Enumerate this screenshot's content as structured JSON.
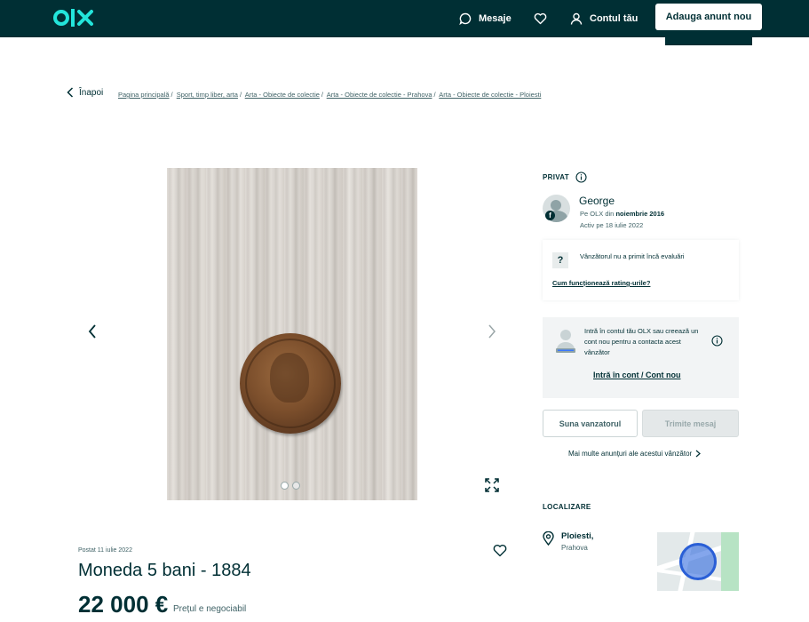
{
  "header": {
    "logo": "OLX",
    "messages_label": "Mesaje",
    "account_label": "Contul tău",
    "post_ad_label": "Adauga anunt nou"
  },
  "breadcrumb": {
    "back_label": "Înapoi",
    "items": [
      "Pagina principală",
      "Sport, timp liber, arta",
      "Arta - Obiecte de colectie",
      "Arta - Obiecte de colectie - Prahova",
      "Arta - Obiecte de colectie - Ploiesti"
    ]
  },
  "gallery": {
    "photo_count": 2,
    "active_index": 1
  },
  "ad": {
    "posted": "Postat 11 iulie 2022",
    "title": "Moneda 5 bani - 1884",
    "price": "22 000 €",
    "negotiable": "Prețul e negociabil"
  },
  "seller": {
    "type_label": "PRIVAT",
    "name": "George",
    "since_prefix": "Pe OLX din",
    "since_value": "noiembrie 2016",
    "active": "Activ pe 18 iulie 2022",
    "rating_text": "Vânzătorul nu a primit încă evaluări",
    "rating_link": "Cum funcționează rating-urile?",
    "login_text": "Intră în contul tău OLX sau creează un cont nou pentru a contacta acest vânzător",
    "login_link": "Intră în cont / Cont nou",
    "call_label": "Suna vanzatorul",
    "message_label": "Trimite mesaj",
    "more_ads_label": "Mai multe anunțuri ale acestui vânzător"
  },
  "location": {
    "heading": "LOCALIZARE",
    "city": "Ploiesti,",
    "region": "Prahova"
  },
  "colors": {
    "brand_dark": "#002f34",
    "brand_teal": "#23e5db",
    "map_circle": "#2a5fd6"
  }
}
